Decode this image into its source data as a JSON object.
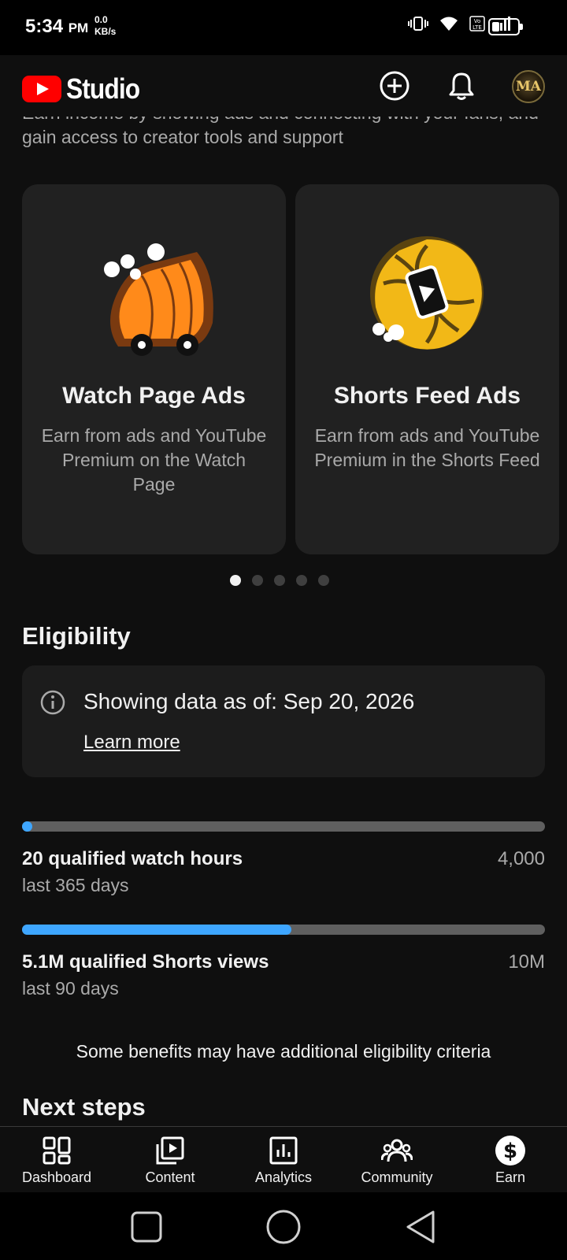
{
  "status_bar": {
    "time": "5:34",
    "ampm": "PM",
    "net_speed": "0.0",
    "net_unit": "KB/s",
    "icons": [
      "vibrate-icon",
      "wifi-icon",
      "volte-icon",
      "signal-icon",
      "battery-icon"
    ]
  },
  "header": {
    "app_name": "Studio",
    "icons": [
      "create-icon",
      "notifications-icon",
      "avatar"
    ],
    "avatar_text": "MA"
  },
  "intro": {
    "text": "Earn income by showing ads and connecting with your fans, and gain access to creator tools and support"
  },
  "cards": [
    {
      "title": "Watch Page Ads",
      "description": "Earn from ads and YouTube Premium on the Watch Page",
      "art": "orange-cart-illustration"
    },
    {
      "title": "Shorts Feed Ads",
      "description": "Earn from ads and YouTube Premium in the Shorts Feed",
      "art": "yellow-shorts-illustration"
    }
  ],
  "carousel": {
    "count": 5,
    "active": 1
  },
  "eligibility": {
    "title": "Eligibility",
    "info_text": "Showing data as of: Sep 20, 2026",
    "learn_more": "Learn more",
    "metrics": [
      {
        "label": "20 qualified watch hours",
        "period": "last 365 days",
        "goal": "4,000",
        "progress": 0.005
      },
      {
        "label": "5.1M qualified Shorts views",
        "period": "last 90 days",
        "goal": "10M",
        "progress": 0.51
      }
    ],
    "note": "Some benefits may have additional eligibility criteria"
  },
  "next_steps": {
    "title": "Next steps"
  },
  "bottom_nav": [
    {
      "label": "Dashboard",
      "icon": "dashboard-icon"
    },
    {
      "label": "Content",
      "icon": "content-icon"
    },
    {
      "label": "Analytics",
      "icon": "analytics-icon"
    },
    {
      "label": "Community",
      "icon": "community-icon"
    },
    {
      "label": "Earn",
      "icon": "earn-icon",
      "active": true
    }
  ],
  "colors": {
    "accent": "#3ea6ff",
    "brand": "#ff0000",
    "background": "#0f0f0f",
    "card": "#212121"
  }
}
